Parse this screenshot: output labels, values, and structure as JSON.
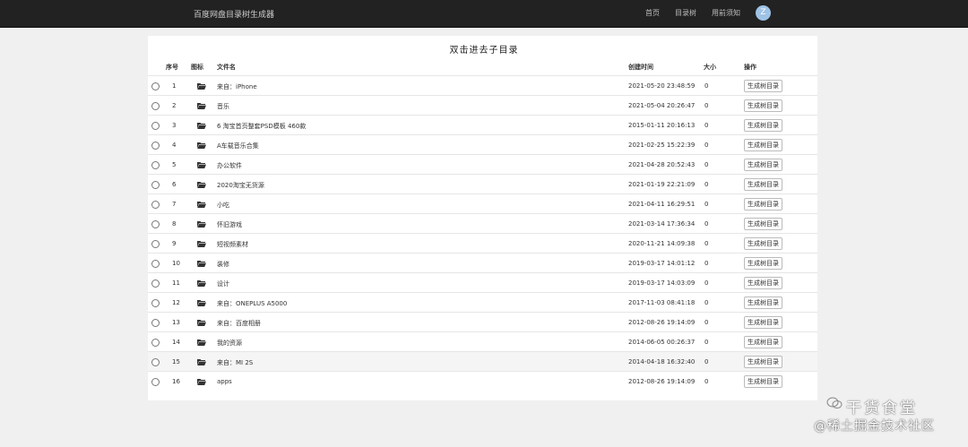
{
  "header": {
    "brand": "百度网盘目录树生成器",
    "nav": [
      {
        "label": "首页"
      },
      {
        "label": "目录树"
      },
      {
        "label": "用前须知"
      }
    ],
    "avatar_letter": "Z"
  },
  "page": {
    "title": "双击进去子目录"
  },
  "table": {
    "columns": {
      "index": "序号",
      "icon": "图标",
      "name": "文件名",
      "created": "创建时间",
      "size": "大小",
      "action": "操作"
    },
    "rows": [
      {
        "index": "1",
        "icon": "folder-open-icon",
        "name": "来自：iPhone",
        "created": "2021-05-20 23:48:59",
        "size": "0",
        "action": "生成树目录"
      },
      {
        "index": "2",
        "icon": "folder-open-icon",
        "name": "音乐",
        "created": "2021-05-04 20:26:47",
        "size": "0",
        "action": "生成树目录"
      },
      {
        "index": "3",
        "icon": "folder-open-icon",
        "name": "6 淘宝首页整套PSD模板 460款",
        "created": "2015-01-11 20:16:13",
        "size": "0",
        "action": "生成树目录"
      },
      {
        "index": "4",
        "icon": "folder-open-icon",
        "name": "A车载音乐合集",
        "created": "2021-02-25 15:22:39",
        "size": "0",
        "action": "生成树目录"
      },
      {
        "index": "5",
        "icon": "folder-open-icon",
        "name": "办公软件",
        "created": "2021-04-28 20:52:43",
        "size": "0",
        "action": "生成树目录"
      },
      {
        "index": "6",
        "icon": "folder-open-icon",
        "name": "2020淘宝无货源",
        "created": "2021-01-19 22:21:09",
        "size": "0",
        "action": "生成树目录"
      },
      {
        "index": "7",
        "icon": "folder-open-icon",
        "name": "小吃",
        "created": "2021-04-11 16:29:51",
        "size": "0",
        "action": "生成树目录"
      },
      {
        "index": "8",
        "icon": "folder-open-icon",
        "name": "怀旧游戏",
        "created": "2021-03-14 17:36:34",
        "size": "0",
        "action": "生成树目录"
      },
      {
        "index": "9",
        "icon": "folder-open-icon",
        "name": "短视频素材",
        "created": "2020-11-21 14:09:38",
        "size": "0",
        "action": "生成树目录"
      },
      {
        "index": "10",
        "icon": "folder-open-icon",
        "name": "装修",
        "created": "2019-03-17 14:01:12",
        "size": "0",
        "action": "生成树目录"
      },
      {
        "index": "11",
        "icon": "folder-open-icon",
        "name": "设计",
        "created": "2019-03-17 14:03:09",
        "size": "0",
        "action": "生成树目录"
      },
      {
        "index": "12",
        "icon": "folder-open-icon",
        "name": "来自：ONEPLUS A5000",
        "created": "2017-11-03 08:41:18",
        "size": "0",
        "action": "生成树目录"
      },
      {
        "index": "13",
        "icon": "folder-open-icon",
        "name": "来自：百度相册",
        "created": "2012-08-26 19:14:09",
        "size": "0",
        "action": "生成树目录"
      },
      {
        "index": "14",
        "icon": "folder-open-icon",
        "name": "我的资源",
        "created": "2014-06-05 00:26:37",
        "size": "0",
        "action": "生成树目录"
      },
      {
        "index": "15",
        "icon": "folder-open-icon",
        "name": "来自：MI 2S",
        "created": "2014-04-18 16:32:40",
        "size": "0",
        "action": "生成树目录"
      },
      {
        "index": "16",
        "icon": "folder-open-icon",
        "name": "apps",
        "created": "2012-08-26 19:14:09",
        "size": "0",
        "action": "生成树目录"
      }
    ]
  },
  "watermark": {
    "line1": "干货食堂",
    "line2": "@稀土掘金技术社区"
  },
  "colors": {
    "topbar": "#222222",
    "page_bg": "#f0f0f0",
    "panel_bg": "#ffffff",
    "avatar": "#9ec3e6",
    "row_highlight": "#f5f5f5"
  }
}
